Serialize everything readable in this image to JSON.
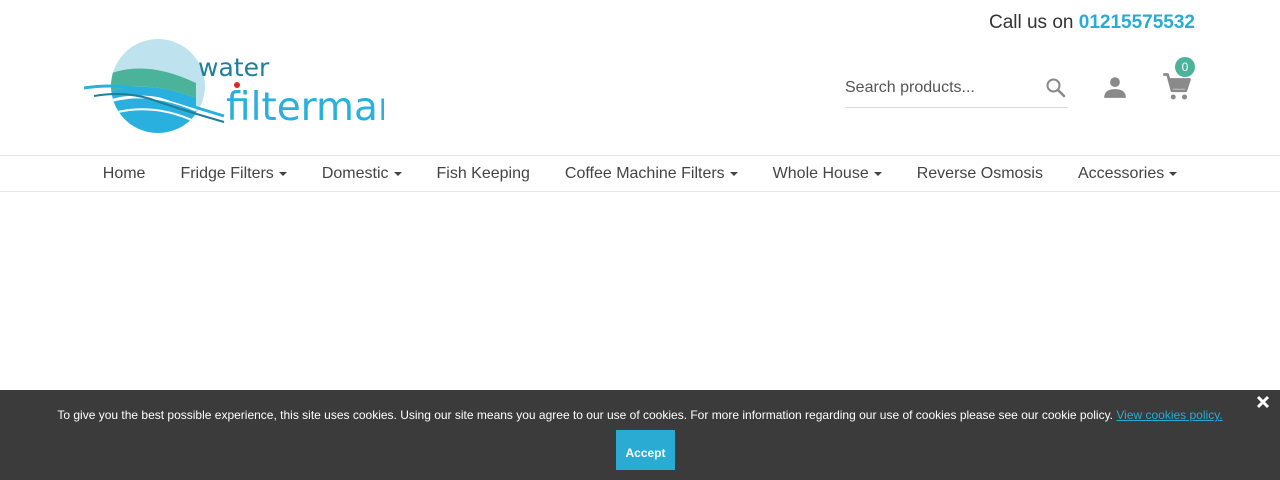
{
  "header": {
    "call_label": "Call us on",
    "phone": "01215575532",
    "logo": {
      "word1": "water",
      "word2": "filterman"
    },
    "search": {
      "placeholder": "Search products..."
    },
    "icons": {
      "search": "search-icon",
      "account": "user-icon",
      "cart": "cart-icon"
    },
    "cart_count": "0"
  },
  "nav": {
    "items": [
      {
        "label": "Home"
      },
      {
        "label": "Fridge Filters"
      },
      {
        "label": "Domestic"
      },
      {
        "label": "Fish Keeping"
      },
      {
        "label": "Coffee Machine Filters"
      },
      {
        "label": "Whole House"
      },
      {
        "label": "Reverse Osmosis"
      },
      {
        "label": "Accessories"
      }
    ]
  },
  "cookie": {
    "message": "To give you the best possible experience, this site uses cookies. Using our site means you agree to our use of cookies. For more information regarding our use of cookies please see our cookie policy.",
    "link": "View cookies policy.",
    "accept": "Accept"
  },
  "colors": {
    "accent": "#29abd4",
    "badge": "#4bb39a",
    "cookie_bar": "#3b3b3b",
    "logo_teal": "#1f7f99",
    "logo_green": "#4bb39a"
  }
}
